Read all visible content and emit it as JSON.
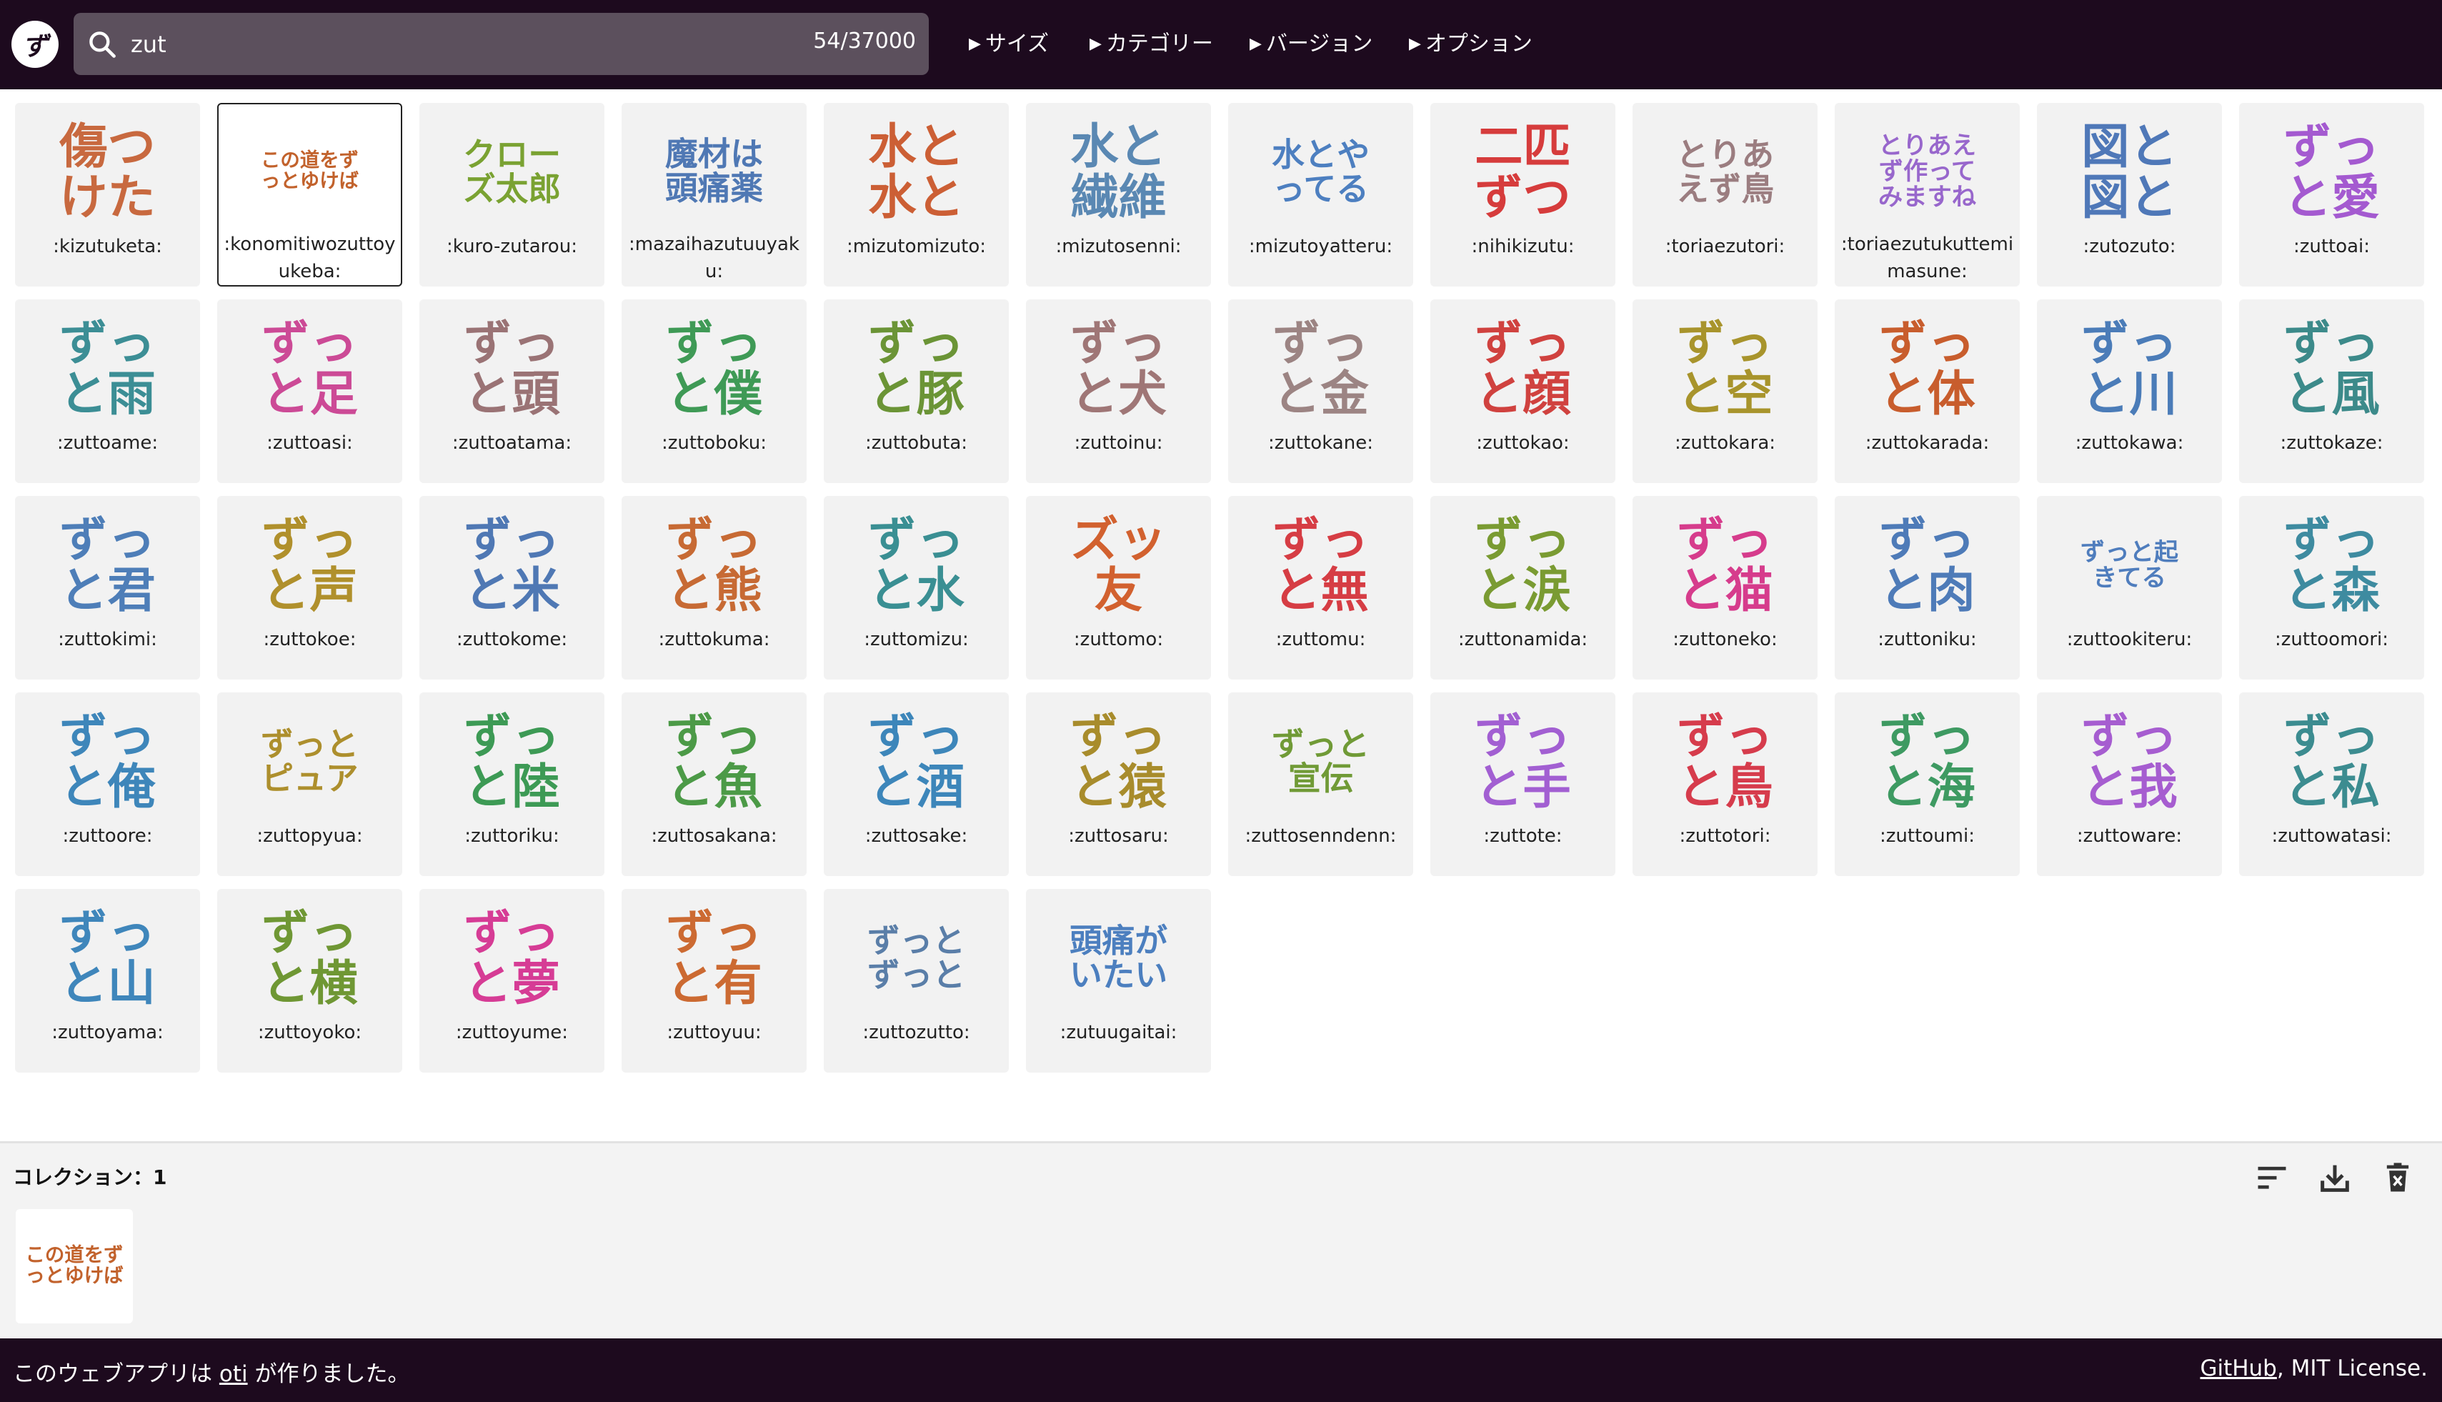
{
  "header": {
    "search_value": "zut",
    "result_count": "54/37000",
    "menus": [
      "サイズ",
      "カテゴリー",
      "バージョン",
      "オプション"
    ]
  },
  "emojis": [
    {
      "lines": [
        "傷つ",
        "けた"
      ],
      "color": "#c8693f",
      "label": ":kizutuketa:"
    },
    {
      "lines": [
        "この道をず",
        "っとゆけば"
      ],
      "color": "#c2622c",
      "label": ":konomitiwozuttoyukeba:",
      "selected": true
    },
    {
      "lines": [
        "クロー",
        "ズ太郎"
      ],
      "color": "#7aa232",
      "label": ":kuro-zutarou:"
    },
    {
      "lines": [
        "魔材は",
        "頭痛薬"
      ],
      "color": "#4f78b4",
      "label": ":mazaihazutuuyaku:"
    },
    {
      "lines": [
        "水と",
        "水と"
      ],
      "color": "#cc5f35",
      "label": ":mizutomizuto:"
    },
    {
      "lines": [
        "水と",
        "繊維"
      ],
      "color": "#5a88b3",
      "label": ":mizutosenni:"
    },
    {
      "lines": [
        "水とや",
        "ってる"
      ],
      "color": "#4d7fc0",
      "label": ":mizutoyatteru:"
    },
    {
      "lines": [
        "二匹",
        "ずつ"
      ],
      "color": "#d63c3c",
      "label": ":nihikizutu:"
    },
    {
      "lines": [
        "とりあ",
        "えず鳥"
      ],
      "color": "#9b7d80",
      "label": ":toriaezutori:"
    },
    {
      "lines": [
        "とりあえ",
        "ず作って",
        "みますね"
      ],
      "color": "#9867cc",
      "label": ":toriaezutukuttemimasune:"
    },
    {
      "lines": [
        "図と",
        "図と"
      ],
      "color": "#4f78b8",
      "label": ":zutozuto:"
    },
    {
      "lines": [
        "ずっ",
        "と愛"
      ],
      "color": "#a45ad0",
      "label": ":zuttoai:"
    },
    {
      "lines": [
        "ずっ",
        "と雨"
      ],
      "color": "#3c8e95",
      "label": ":zuttoame:"
    },
    {
      "lines": [
        "ずっ",
        "と足"
      ],
      "color": "#cc4a96",
      "label": ":zuttoasi:"
    },
    {
      "lines": [
        "ずっ",
        "と頭"
      ],
      "color": "#9a7375",
      "label": ":zuttoatama:"
    },
    {
      "lines": [
        "ずっ",
        "と僕"
      ],
      "color": "#3f9a56",
      "label": ":zuttoboku:"
    },
    {
      "lines": [
        "ずっ",
        "と豚"
      ],
      "color": "#6b9436",
      "label": ":zuttobuta:"
    },
    {
      "lines": [
        "ずっ",
        "と犬"
      ],
      "color": "#9f7676",
      "label": ":zuttoinu:"
    },
    {
      "lines": [
        "ずっ",
        "と金"
      ],
      "color": "#9c8483",
      "label": ":zuttokane:"
    },
    {
      "lines": [
        "ずっ",
        "と顔"
      ],
      "color": "#d0423f",
      "label": ":zuttokao:"
    },
    {
      "lines": [
        "ずっ",
        "と空"
      ],
      "color": "#a8942c",
      "label": ":zuttokara:"
    },
    {
      "lines": [
        "ずっ",
        "と体"
      ],
      "color": "#c85d2d",
      "label": ":zuttokarada:"
    },
    {
      "lines": [
        "ずっ",
        "と川"
      ],
      "color": "#4b7cb8",
      "label": ":zuttokawa:"
    },
    {
      "lines": [
        "ずっ",
        "と風"
      ],
      "color": "#3c8a8a",
      "label": ":zuttokaze:"
    },
    {
      "lines": [
        "ずっ",
        "と君"
      ],
      "color": "#4e7eb8",
      "label": ":zuttokimi:"
    },
    {
      "lines": [
        "ずっ",
        "と声"
      ],
      "color": "#b0902c",
      "label": ":zuttokoe:"
    },
    {
      "lines": [
        "ずっ",
        "と米"
      ],
      "color": "#4f78b4",
      "label": ":zuttokome:"
    },
    {
      "lines": [
        "ずっ",
        "と熊"
      ],
      "color": "#c76a34",
      "label": ":zuttokuma:"
    },
    {
      "lines": [
        "ずっ",
        "と水"
      ],
      "color": "#3a8f93",
      "label": ":zuttomizu:"
    },
    {
      "lines": [
        "ズッ",
        "友"
      ],
      "color": "#d2612f",
      "label": ":zuttomo:"
    },
    {
      "lines": [
        "ずっ",
        "と無"
      ],
      "color": "#d63d44",
      "label": ":zuttomu:"
    },
    {
      "lines": [
        "ずっ",
        "と涙"
      ],
      "color": "#7a9b32",
      "label": ":zuttonamida:"
    },
    {
      "lines": [
        "ずっ",
        "と猫"
      ],
      "color": "#d63c8c",
      "label": ":zuttoneko:"
    },
    {
      "lines": [
        "ずっ",
        "と肉"
      ],
      "color": "#4e7bb8",
      "label": ":zuttoniku:"
    },
    {
      "lines": [
        "ずっと起",
        "きてる"
      ],
      "color": "#4f7dbd",
      "label": ":zuttookiteru:"
    },
    {
      "lines": [
        "ずっ",
        "と森"
      ],
      "color": "#3e8ba0",
      "label": ":zuttoomori:"
    },
    {
      "lines": [
        "ずっ",
        "と俺"
      ],
      "color": "#3e86ba",
      "label": ":zuttoore:"
    },
    {
      "lines": [
        "ずっと",
        "ピュア"
      ],
      "color": "#ad8f2d",
      "label": ":zuttopyua:"
    },
    {
      "lines": [
        "ずっ",
        "と陸"
      ],
      "color": "#3d9a55",
      "label": ":zuttoriku:"
    },
    {
      "lines": [
        "ずっ",
        "と魚"
      ],
      "color": "#4c9a47",
      "label": ":zuttosakana:"
    },
    {
      "lines": [
        "ずっ",
        "と酒"
      ],
      "color": "#3d86ba",
      "label": ":zuttosake:"
    },
    {
      "lines": [
        "ずっ",
        "と猿"
      ],
      "color": "#a88c2c",
      "label": ":zuttosaru:"
    },
    {
      "lines": [
        "ずっと",
        "宣伝"
      ],
      "color": "#709a36",
      "label": ":zuttosenndenn:"
    },
    {
      "lines": [
        "ずっ",
        "と手"
      ],
      "color": "#a25fd2",
      "label": ":zuttote:"
    },
    {
      "lines": [
        "ずっ",
        "と鳥"
      ],
      "color": "#d63c4c",
      "label": ":zuttotori:"
    },
    {
      "lines": [
        "ずっ",
        "と海"
      ],
      "color": "#3e9a62",
      "label": ":zuttoumi:"
    },
    {
      "lines": [
        "ずっ",
        "と我"
      ],
      "color": "#a65dd0",
      "label": ":zuttoware:"
    },
    {
      "lines": [
        "ずっ",
        "と私"
      ],
      "color": "#3c8c90",
      "label": ":zuttowatasi:"
    },
    {
      "lines": [
        "ずっ",
        "と山"
      ],
      "color": "#3f86bb",
      "label": ":zuttoyama:"
    },
    {
      "lines": [
        "ずっ",
        "と横"
      ],
      "color": "#6f9734",
      "label": ":zuttoyoko:"
    },
    {
      "lines": [
        "ずっ",
        "と夢"
      ],
      "color": "#d63c95",
      "label": ":zuttoyume:"
    },
    {
      "lines": [
        "ずっ",
        "と有"
      ],
      "color": "#cc6a32",
      "label": ":zuttoyuu:"
    },
    {
      "lines": [
        "ずっと",
        "ずっと"
      ],
      "color": "#5a7ea8",
      "label": ":zuttozutto:"
    },
    {
      "lines": [
        "頭痛が",
        "いたい"
      ],
      "color": "#4c7fbf",
      "label": ":zutuugaitai:"
    }
  ],
  "collection": {
    "title": "コレクション：1",
    "items": [
      {
        "lines": [
          "この道をず",
          "っとゆけば"
        ],
        "color": "#c2622c"
      }
    ]
  },
  "footer": {
    "text_before": "このウェブアプリは ",
    "author": "oti",
    "text_after": " が作りました。",
    "github": "GitHub",
    "license": ", MIT License."
  }
}
